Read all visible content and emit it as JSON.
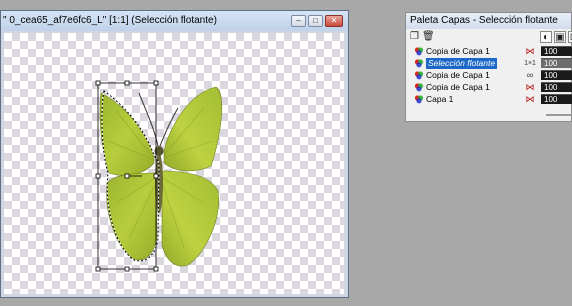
{
  "image_window": {
    "title": "\" 0_cea65_af7e6fc6_L\" [1:1] (Selección flotante)",
    "buttons": {
      "minimize": "–",
      "maximize": "□",
      "close": "✕"
    }
  },
  "layers_palette": {
    "title": "Paleta Capas - Selección flotante",
    "toolbar": {
      "new_layer_icon": "new-layer-icon",
      "delete_icon": "trash-icon"
    },
    "layers": [
      {
        "name": "Copia de Capa 1",
        "flag": "mask-icon",
        "flag_glyph": "⋈",
        "opacity": "100",
        "selected": false
      },
      {
        "name": "Selección flotante",
        "flag": "float-icon",
        "flag_glyph": "1×1",
        "opacity": "100",
        "selected": true
      },
      {
        "name": "Copia de Capa 1",
        "flag": "glasses-icon",
        "flag_glyph": "∞",
        "opacity": "100",
        "selected": false
      },
      {
        "name": "Copia de Capa 1",
        "flag": "mask-icon",
        "flag_glyph": "⋈",
        "opacity": "100",
        "selected": false
      },
      {
        "name": "Capa 1",
        "flag": "mask-icon",
        "flag_glyph": "⋈",
        "opacity": "100",
        "selected": false
      }
    ]
  },
  "colors": {
    "selection_highlight": "#1c67c8",
    "butterfly_green": "#a9c23a",
    "checker": "#dcd6de"
  }
}
